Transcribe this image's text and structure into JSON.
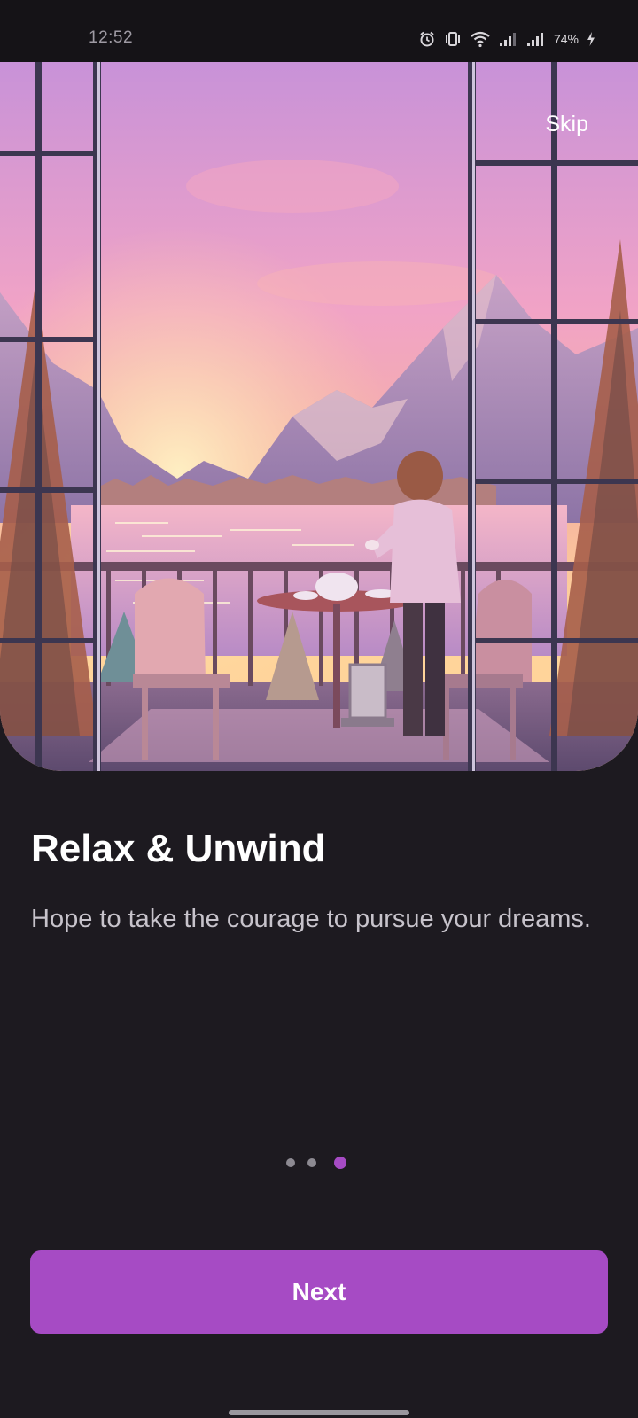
{
  "status_bar": {
    "time": "12:52",
    "battery": "74%",
    "icons": [
      "alarm-icon",
      "vibrate-icon",
      "wifi-icon",
      "signal-icon",
      "signal-icon",
      "battery-charging-icon"
    ]
  },
  "onboarding": {
    "skip_label": "Skip",
    "title": "Relax & Unwind",
    "description": "Hope to take the courage to pursue your dreams.",
    "page_count": 3,
    "current_page": 3,
    "next_label": "Next"
  },
  "colors": {
    "background": "#1d1a20",
    "accent": "#a64bc4",
    "dot_inactive": "#8d8a92"
  }
}
